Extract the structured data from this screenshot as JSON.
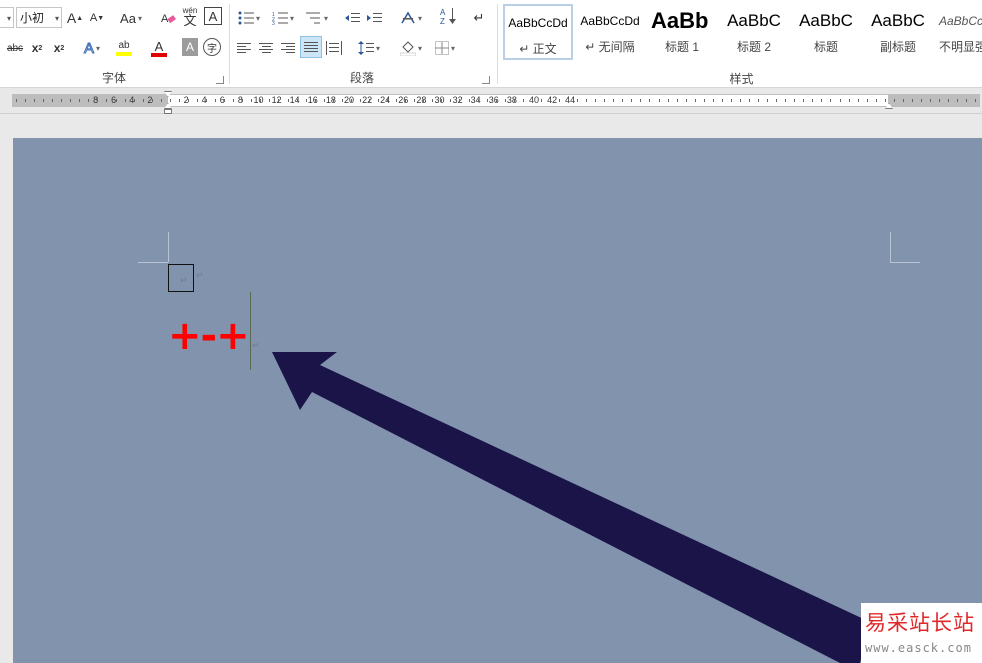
{
  "ribbon": {
    "font_group": {
      "title": "字体",
      "font_size": "小初",
      "grow_label": "A",
      "shrink_label": "A",
      "case_label": "Aa",
      "phonetic_label": "wén",
      "phonetic_char": "文",
      "char_border_label": "A",
      "strike_label": "abc",
      "subscript_label": "x",
      "superscript_label": "x",
      "text_effect_label": "A",
      "highlight_label": "ab",
      "font_color_label": "A",
      "char_shading_label": "A",
      "enclose_label": "字"
    },
    "paragraph_group": {
      "title": "段落"
    },
    "styles_group": {
      "title": "样式",
      "items": [
        {
          "sample": "AaBbCcDd",
          "name": "↵ 正文"
        },
        {
          "sample": "AaBbCcDd",
          "name": "↵ 无间隔"
        },
        {
          "sample": "AaBb",
          "name": "标题 1"
        },
        {
          "sample": "AaBbC",
          "name": "标题 2"
        },
        {
          "sample": "AaBbC",
          "name": "标题"
        },
        {
          "sample": "AaBbC",
          "name": "副标题"
        },
        {
          "sample": "AaBbCc",
          "name": "不明显强"
        }
      ]
    }
  },
  "ruler": {
    "labels": [
      "8",
      "6",
      "4",
      "2",
      "2",
      "4",
      "6",
      "8",
      "10",
      "12",
      "14",
      "16",
      "18",
      "20",
      "22",
      "24",
      "26",
      "28",
      "30",
      "32",
      "34",
      "36",
      "38",
      "40",
      "42",
      "44"
    ]
  },
  "document": {
    "text": "+-+",
    "text_color": "#ff0000",
    "page_background": "#8294ad",
    "arrow_color": "#1a1448"
  },
  "watermark": {
    "cn": "易采站长站",
    "url": "www.easck.com"
  }
}
